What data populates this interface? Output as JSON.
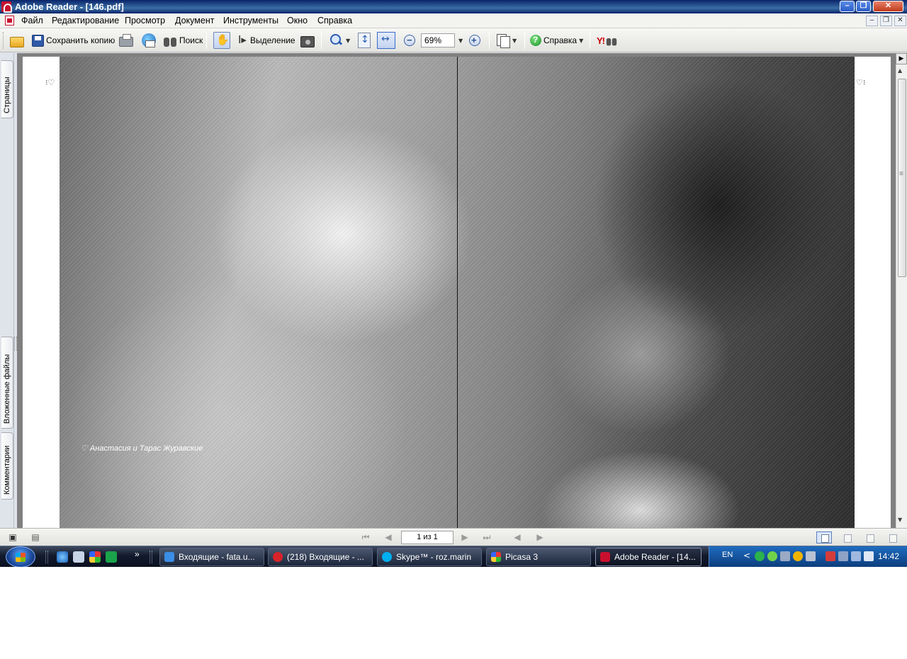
{
  "window": {
    "title": "Adobe Reader - [146.pdf]",
    "buttons": {
      "minimize": "–",
      "restore": "❐",
      "close": "✕"
    }
  },
  "menu": {
    "items": [
      "Файл",
      "Редактирование",
      "Просмотр",
      "Документ",
      "Инструменты",
      "Окно",
      "Справка"
    ],
    "mdi": {
      "minimize": "–",
      "restore": "❐",
      "close": "✕"
    }
  },
  "toolbar": {
    "save_copy": "Сохранить копию",
    "search": "Поиск",
    "select": "Выделение",
    "zoom_value": "69%",
    "help": "Справка",
    "yahoo": "Y!"
  },
  "left_panel": {
    "tabs": [
      "Страницы",
      "Вложенные файлы",
      "Комментарии"
    ]
  },
  "document": {
    "caption": "♡ Анастасия и Тарас Журавские",
    "corner_left": "⁝♡",
    "corner_right": "♡⁝"
  },
  "status": {
    "page_indicator": "1 из 1",
    "nav": {
      "first": "⏮",
      "prev": "◀",
      "next": "▶",
      "last": "⏭",
      "back": "◀",
      "forward": "▶"
    }
  },
  "taskbar": {
    "quicklaunch_more": "»",
    "tasks": [
      {
        "label": "Входящие - fata.u...",
        "color": "#3a8ee6"
      },
      {
        "label": "(218) Входящие - ...",
        "color": "#d8232a"
      },
      {
        "label": "Skype™ - roz.marin",
        "color": "#00aff0"
      },
      {
        "label": "Picasa 3",
        "color": "#e8b21f"
      },
      {
        "label": "Adobe Reader - [14...",
        "color": "#c8102e"
      }
    ],
    "tray": {
      "language": "EN",
      "chevron": "<",
      "time": "14:42"
    }
  }
}
